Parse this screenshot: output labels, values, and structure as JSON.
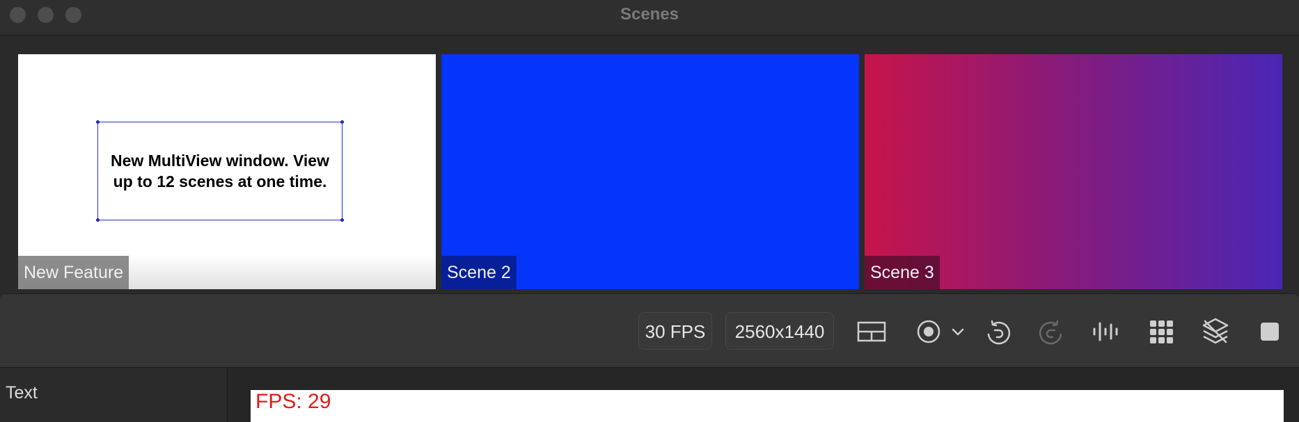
{
  "window": {
    "title": "Scenes"
  },
  "scenes": [
    {
      "label": "New Feature",
      "content_text": "New MultiView window. View up to 12 scenes at one time."
    },
    {
      "label": "Scene 2"
    },
    {
      "label": "Scene 3"
    }
  ],
  "toolbar": {
    "fps": "30 FPS",
    "resolution": "2560x1440",
    "icons": [
      "multiview-grid-icon",
      "record-icon",
      "chevron-down-icon",
      "undo-icon",
      "redo-icon",
      "audio-icon",
      "apps-grid-icon",
      "layers-icon",
      "stop-icon"
    ]
  },
  "sidebar": {
    "label": "Text"
  },
  "preview": {
    "fps_text": "FPS: 29"
  },
  "colors": {
    "scene2": "#0534fb",
    "scene3_start": "#c7144a",
    "scene3_end": "#4a26b6",
    "fps_text": "#e21b1b"
  }
}
